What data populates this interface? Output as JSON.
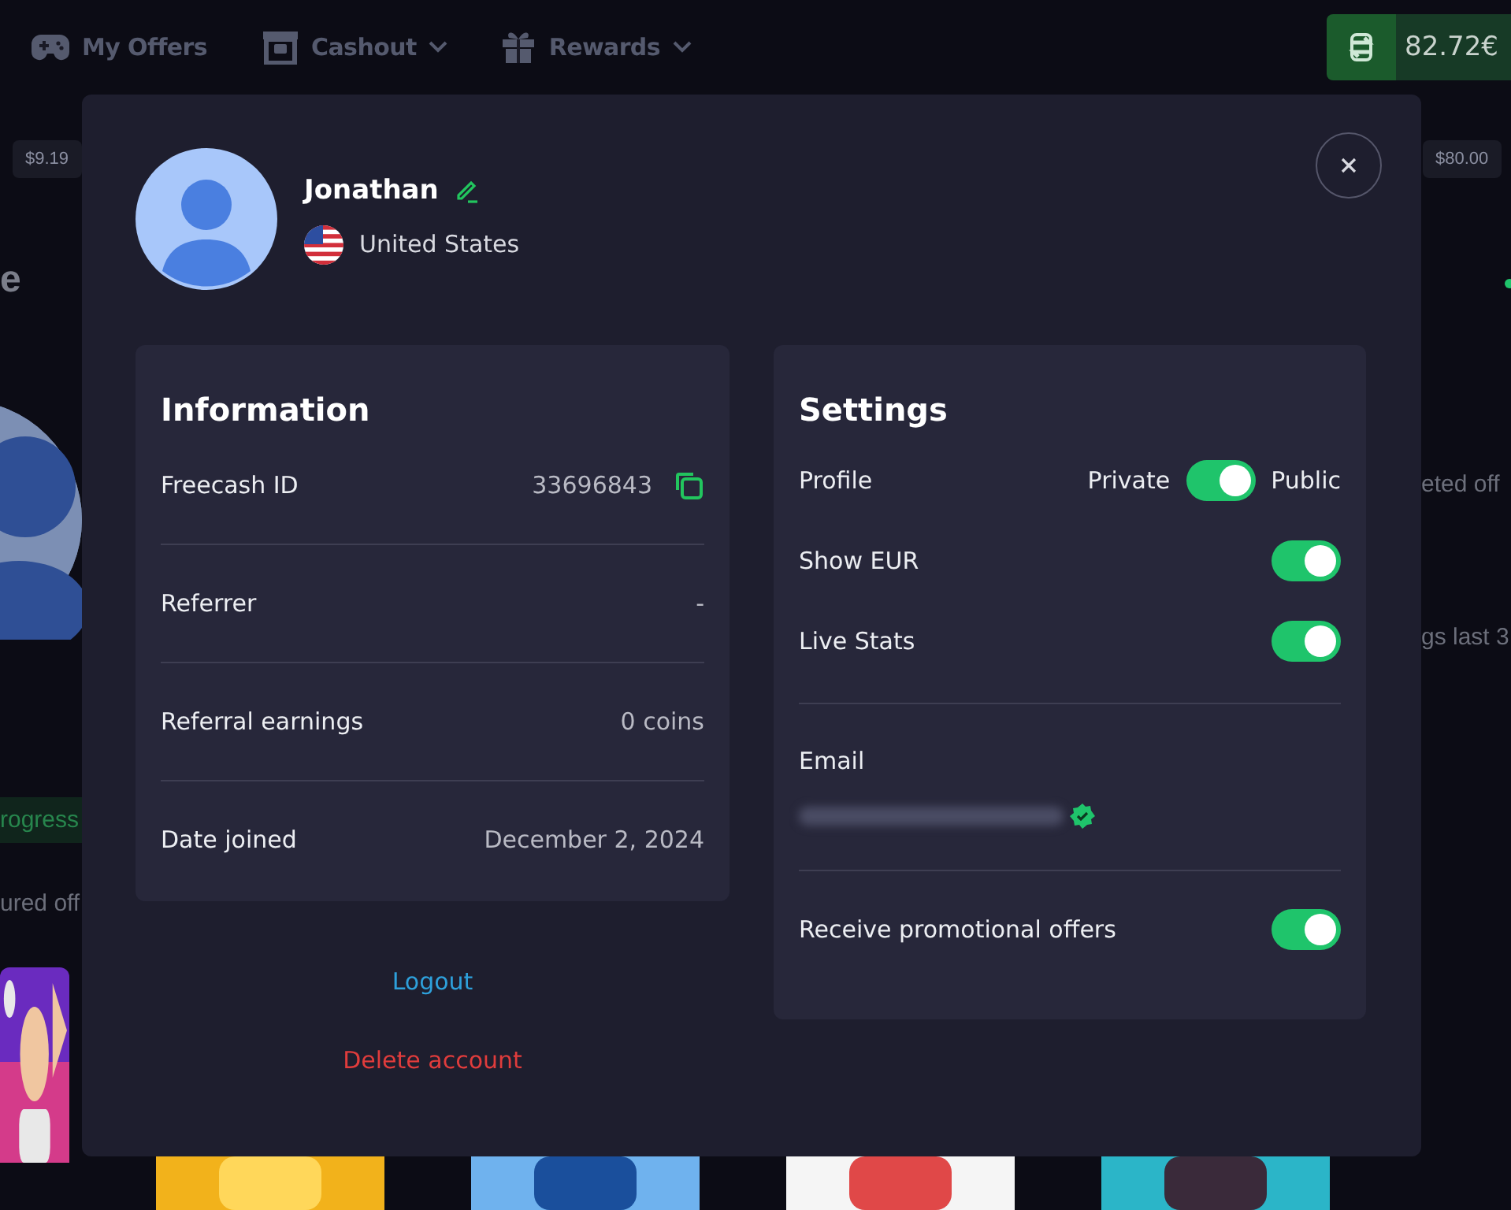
{
  "nav": {
    "items": [
      {
        "label": "My Offers",
        "dropdown": false
      },
      {
        "label": "Cashout",
        "dropdown": true
      },
      {
        "label": "Rewards",
        "dropdown": true
      }
    ],
    "balance": "82.72€"
  },
  "background": {
    "left": [
      {
        "kind": "chip",
        "text": "$9.19"
      },
      {
        "kind": "heading",
        "text": "e"
      },
      {
        "kind": "avatar"
      },
      {
        "kind": "status",
        "text": "rogress"
      },
      {
        "kind": "text",
        "text": "ured off"
      },
      {
        "kind": "picture"
      }
    ],
    "right": [
      {
        "kind": "chip",
        "text": "$80.00"
      },
      {
        "kind": "dot"
      },
      {
        "kind": "text",
        "text": "eted off"
      },
      {
        "kind": "text",
        "text": "gs last 3"
      }
    ],
    "thumbnails": [
      {
        "kind": "picture"
      },
      {
        "kind": "picture"
      },
      {
        "kind": "picture"
      },
      {
        "kind": "picture"
      }
    ]
  },
  "profile": {
    "name": "Jonathan",
    "country": "United States"
  },
  "information": {
    "title": "Information",
    "rows": [
      {
        "label": "Freecash ID",
        "value": "33696843",
        "copyable": true
      },
      {
        "label": "Referrer",
        "value": "-",
        "copyable": false
      },
      {
        "label": "Referral earnings",
        "value": "0 coins",
        "copyable": false
      },
      {
        "label": "Date joined",
        "value": "December 2, 2024",
        "copyable": false
      }
    ]
  },
  "actions": {
    "logout": "Logout",
    "delete": "Delete account"
  },
  "settings": {
    "title": "Settings",
    "profile": {
      "label": "Profile",
      "off_label": "Private",
      "on_label": "Public",
      "on": true
    },
    "toggles": [
      {
        "label": "Show EUR",
        "on": true
      },
      {
        "label": "Live Stats",
        "on": true
      }
    ],
    "email": {
      "label": "Email",
      "verified": true
    },
    "promo": {
      "label": "Receive promotional offers",
      "on": true
    }
  }
}
